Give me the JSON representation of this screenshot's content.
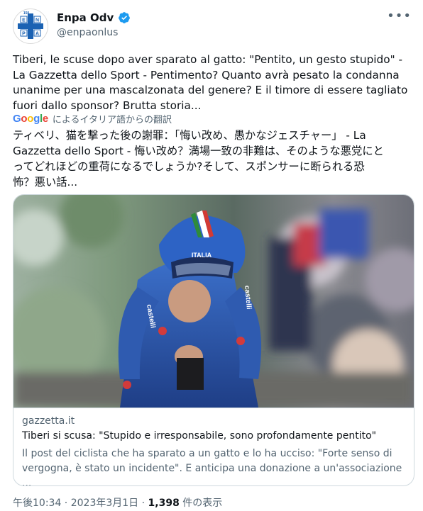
{
  "author": {
    "display_name": "Enpa Odv",
    "handle": "@enpaonlus",
    "avatar_letters": [
      "E",
      "N",
      "P",
      "A"
    ],
    "avatar_year": "150"
  },
  "tweet": {
    "text": "Tiberi, le scuse dopo aver sparato al gatto: \"Pentito, un gesto stupido\" -\nLa Gazzetta dello Sport - Pentimento? Quanto avrà pesato la condanna\nunanime per una mascalzonata del genere? E il timore di essere tagliato\nfuori dallo sponsor? Brutta storia..."
  },
  "translation": {
    "google_logo": "Google",
    "label": "によるイタリア語からの翻訳",
    "text": "ティベリ、猫を撃った後の謝罪：「悔い改め、愚かなジェスチャー」 - La\nGazzetta dello Sport - 悔い改め？満場一致の非難は、そのような悪党にと\nってどれほどの重荷になるでしょうか?そして、スポンサーに断られる恐\n怖？悪い話..."
  },
  "card": {
    "image_helmet_text": "ITALIA",
    "image_suit_text": "castelli",
    "domain": "gazzetta.it",
    "title": "Tiberi si scusa: \"Stupido e irresponsabile, sono profondamente pentito\"",
    "description": "Il post del ciclista che ha sparato a un gatto e lo ha ucciso: \"Forte senso di\nvergogna, è stato un incidente\". E anticipa una donazione a un'associazione ..."
  },
  "meta": {
    "time": "午後10:34",
    "separator": " · ",
    "date": "2023年3月1日",
    "views_count": "1,398",
    "views_label": " 件の表示"
  },
  "colors": {
    "verified": "#1d9bf0",
    "enpa_blue": "#1b62b3",
    "secondary_text": "#536471"
  }
}
